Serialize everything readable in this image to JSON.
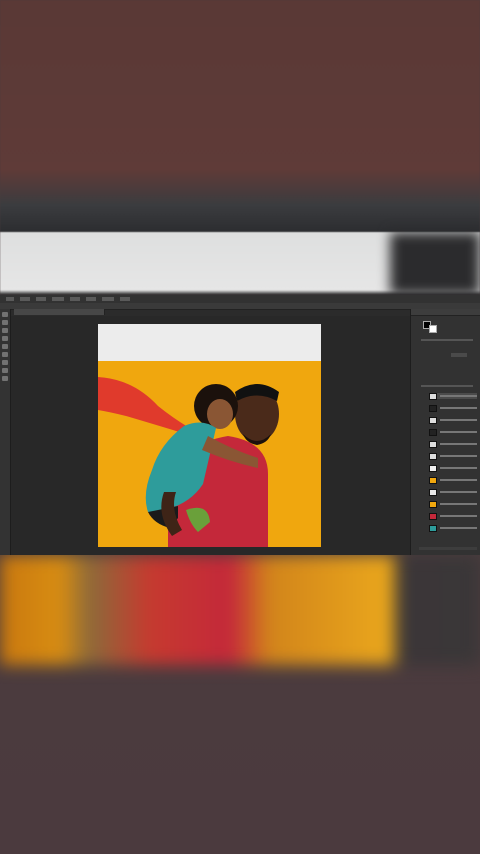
{
  "app": {
    "canvas_document": {
      "layers_count": 15
    }
  },
  "colors": {
    "background_top": "#5f3b38",
    "background_bottom": "#4b3a3e",
    "workspace": "#282828",
    "photo_backdrop": "#f0a70e",
    "shirt": "#c4283a",
    "child_shirt": "#2e9c9b",
    "cape": "#e03a2c"
  },
  "icons": [
    "move-tool-icon",
    "marquee-tool-icon",
    "lasso-tool-icon",
    "crop-tool-icon",
    "brush-tool-icon",
    "eraser-tool-icon",
    "text-tool-icon",
    "hand-tool-icon",
    "zoom-tool-icon"
  ]
}
